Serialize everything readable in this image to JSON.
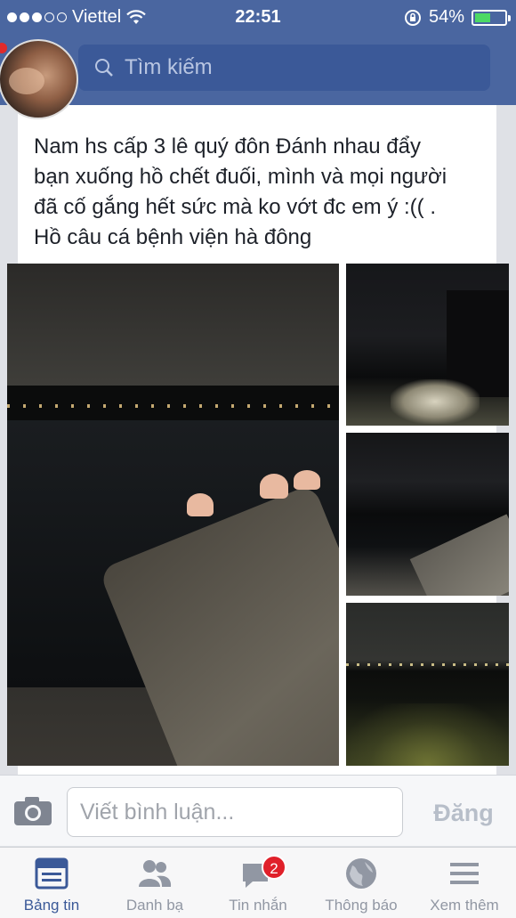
{
  "status_bar": {
    "carrier": "Viettel",
    "time": "22:51",
    "battery": "54%",
    "battery_level": 0.54
  },
  "search": {
    "placeholder": "Tìm kiếm"
  },
  "post": {
    "text": "Nam hs cấp 3 lê quý đôn Đánh nhau đẩy\nbạn xuống hồ chết đuối, mình và mọi người\nđã cố gắng hết sức mà ko vớt đc em ý :(( .\nHồ câu cá bệnh viện hà đông"
  },
  "comment": {
    "placeholder": "Viết bình luận...",
    "post_label": "Đăng"
  },
  "tabs": [
    {
      "label": "Bảng tin",
      "icon": "news-feed-icon",
      "active": true
    },
    {
      "label": "Danh bạ",
      "icon": "friends-icon",
      "active": false
    },
    {
      "label": "Tin nhắn",
      "icon": "messages-icon",
      "active": false,
      "badge": "2"
    },
    {
      "label": "Thông báo",
      "icon": "globe-icon",
      "active": false
    },
    {
      "label": "Xem thêm",
      "icon": "menu-icon",
      "active": false
    }
  ],
  "colors": {
    "header": "#4a66a0",
    "search_bg": "#3b5998",
    "active_tab": "#3b5998",
    "badge": "#e0202a",
    "battery": "#4cd964"
  }
}
